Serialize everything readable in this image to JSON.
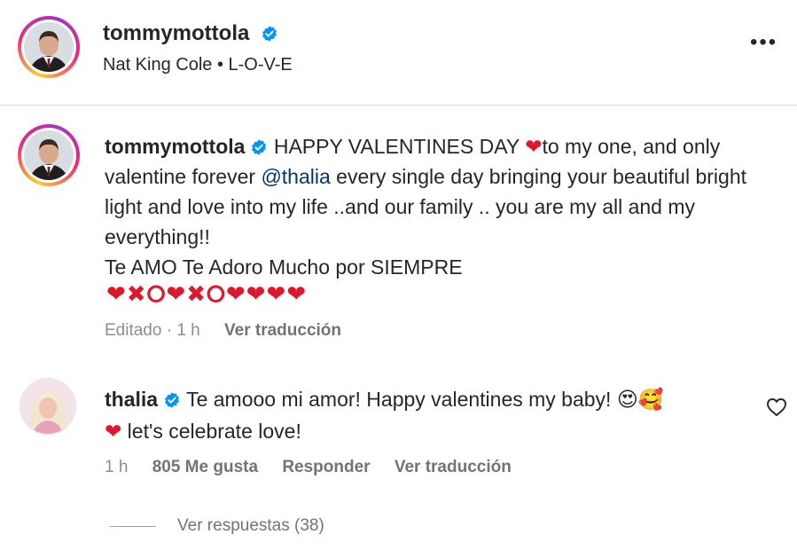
{
  "post": {
    "username": "tommymottola",
    "song": "Nat King Cole • L-O-V-E"
  },
  "caption": {
    "username": "tommymottola",
    "text_1": "HAPPY VALENTINES DAY",
    "text_2": "to my one, and only valentine forever",
    "mention": "@thalia",
    "text_3": "every single day bringing your beautiful bright light and love into my life ..and our family .. you are my all and my everything!!",
    "text_4": "Te AMO Te Adoro Mucho por SIEMPRE",
    "meta": "Editado · 1 h",
    "translate": "Ver traducción"
  },
  "comment": {
    "username": "thalia",
    "text_1": "Te amooo mi amor! Happy valentines my baby!",
    "text_2": "let's celebrate love!",
    "time": "1 h",
    "likes": "805 Me gusta",
    "reply": "Responder",
    "translate": "Ver traducción",
    "view_replies": "Ver respuestas (38)"
  },
  "icons": {
    "verified": "verified-badge",
    "more": "more-options",
    "like": "heart-outline"
  },
  "colors": {
    "verified": "#0095f6",
    "heart": "#e0162b",
    "mention": "#00376b",
    "muted": "#8e8e8e"
  }
}
